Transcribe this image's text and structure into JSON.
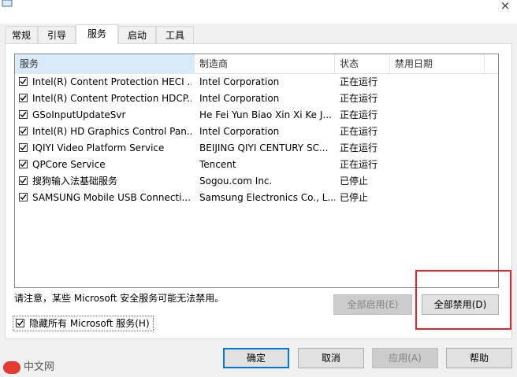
{
  "window": {
    "close_glyph": "×"
  },
  "tabs": [
    {
      "label": "常规"
    },
    {
      "label": "引导"
    },
    {
      "label": "服务"
    },
    {
      "label": "启动"
    },
    {
      "label": "工具"
    }
  ],
  "services": {
    "columns": [
      "服务",
      "制造商",
      "状态",
      "禁用日期"
    ],
    "rows": [
      {
        "checked": true,
        "name": "Intel(R) Content Protection HECI ...",
        "maker": "Intel Corporation",
        "status": "正在运行",
        "date": ""
      },
      {
        "checked": true,
        "name": "Intel(R) Content Protection HDCP...",
        "maker": "Intel Corporation",
        "status": "正在运行",
        "date": ""
      },
      {
        "checked": true,
        "name": "GSoInputUpdateSvr",
        "maker": "He Fei Yun Biao Xin Xi Ke J...",
        "status": "正在运行",
        "date": ""
      },
      {
        "checked": true,
        "name": "Intel(R) HD Graphics Control Pan...",
        "maker": "Intel Corporation",
        "status": "正在运行",
        "date": ""
      },
      {
        "checked": true,
        "name": "IQIYI Video Platform Service",
        "maker": "BEIJING QIYI CENTURY SC...",
        "status": "正在运行",
        "date": ""
      },
      {
        "checked": true,
        "name": "QPCore Service",
        "maker": "Tencent",
        "status": "正在运行",
        "date": ""
      },
      {
        "checked": true,
        "name": "搜狗输入法基础服务",
        "maker": "Sogou.com Inc.",
        "status": "已停止",
        "date": ""
      },
      {
        "checked": true,
        "name": "SAMSUNG Mobile USB Connecti...",
        "maker": "Samsung Electronics Co., L...",
        "status": "已停止",
        "date": ""
      }
    ]
  },
  "note": "请注意，某些 Microsoft 安全服务可能无法禁用。",
  "buttons": {
    "enable_all": "全部启用(E)",
    "disable_all": "全部禁用(D)",
    "ok": "确定",
    "cancel": "取消",
    "apply": "应用(A)",
    "help": "帮助"
  },
  "hide_ms": {
    "label": "隐藏所有 Microsoft 服务(H)",
    "checked": true
  },
  "watermark": {
    "logo_text": "php",
    "text": "中文网"
  },
  "colors": {
    "highlight": "#e0262b",
    "header_selected": "#d9ebf9",
    "default_button_border": "#0078d7"
  }
}
